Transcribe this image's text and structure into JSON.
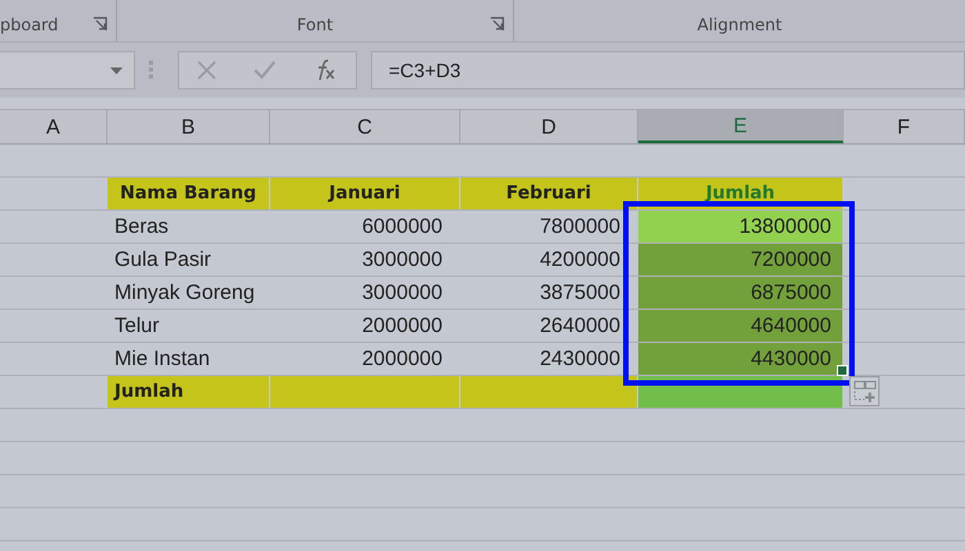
{
  "ribbon": {
    "groups": [
      {
        "label": "pboard",
        "launcher": true
      },
      {
        "label": "Font",
        "launcher": true
      },
      {
        "label": "Alignment",
        "launcher": false
      }
    ]
  },
  "formula_bar": {
    "formula": "=C3+D3"
  },
  "columns": [
    {
      "label": "A",
      "selected": false
    },
    {
      "label": "B",
      "selected": false
    },
    {
      "label": "C",
      "selected": false
    },
    {
      "label": "D",
      "selected": false
    },
    {
      "label": "E",
      "selected": true
    },
    {
      "label": "F",
      "selected": false
    }
  ],
  "rows": [
    {
      "kind": "header",
      "cells": [
        "Nama Barang",
        "Januari",
        "Februari",
        "Jumlah"
      ]
    },
    {
      "kind": "data",
      "active": true,
      "selected": true,
      "cells": [
        "Beras",
        "6000000",
        "7800000",
        "13800000"
      ]
    },
    {
      "kind": "data",
      "active": false,
      "selected": true,
      "cells": [
        "Gula Pasir",
        "3000000",
        "4200000",
        "7200000"
      ]
    },
    {
      "kind": "data",
      "active": false,
      "selected": true,
      "cells": [
        "Minyak Goreng",
        "3000000",
        "3875000",
        "6875000"
      ]
    },
    {
      "kind": "data",
      "active": false,
      "selected": true,
      "cells": [
        "Telur",
        "2000000",
        "2640000",
        "4640000"
      ]
    },
    {
      "kind": "data",
      "active": false,
      "selected": true,
      "cells": [
        "Mie Instan",
        "2000000",
        "2430000",
        "4430000"
      ]
    },
    {
      "kind": "total",
      "cells": [
        "Jumlah"
      ]
    }
  ]
}
